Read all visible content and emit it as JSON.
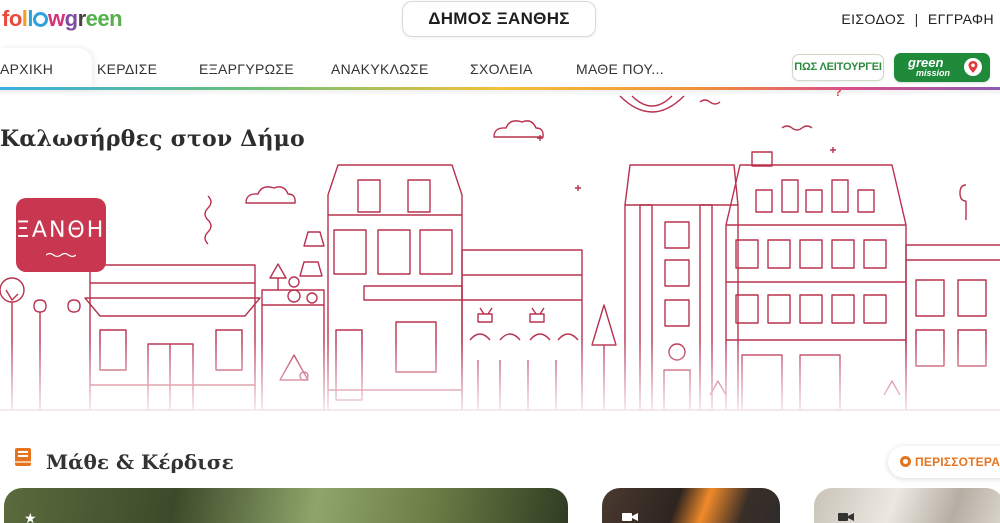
{
  "brand": {
    "logo_parts": [
      "fo",
      "l",
      "l",
      "o",
      "w",
      "g",
      "r",
      "e",
      "e",
      "n"
    ],
    "logo_text": "followgreen"
  },
  "header": {
    "municipality": "ΔΗΜΟΣ ΞΑΝΘΗΣ",
    "login": "ΕΙΣΟΔΟΣ",
    "separator": "|",
    "register": "ΕΓΓΡΑΦΗ"
  },
  "nav": {
    "items": [
      {
        "label": "ΑΡΧΙΚΗ",
        "active": true
      },
      {
        "label": "ΚΕΡΔΙΣΕ",
        "active": false
      },
      {
        "label": "ΕΞΑΡΓΥΡΩΣΕ",
        "active": false
      },
      {
        "label": "ΑΝΑΚΥΚΛΩΣΕ",
        "active": false
      },
      {
        "label": "ΣΧΟΛΕΙΑ",
        "active": false
      },
      {
        "label": "ΜΑΘΕ ΠΟΥ...",
        "active": false
      }
    ],
    "how_it_works": "ΠΩΣ ΛΕΙΤΟΥΡΓΕΙ",
    "how_it_works_mark": "?",
    "green_mission_1": "green",
    "green_mission_2": "mission"
  },
  "hero": {
    "title": "Καλωσήρθες στον Δήμο",
    "city_badge": "ΞΑΝΘΗΣ"
  },
  "section": {
    "title": "Μάθε & Κέρδισε",
    "more": "ΠΕΡΙΣΣΟΤΕΡΑ"
  },
  "colors": {
    "accent": "#c9364f",
    "brand_green": "#1f8a3a",
    "orange": "#e5741f"
  }
}
